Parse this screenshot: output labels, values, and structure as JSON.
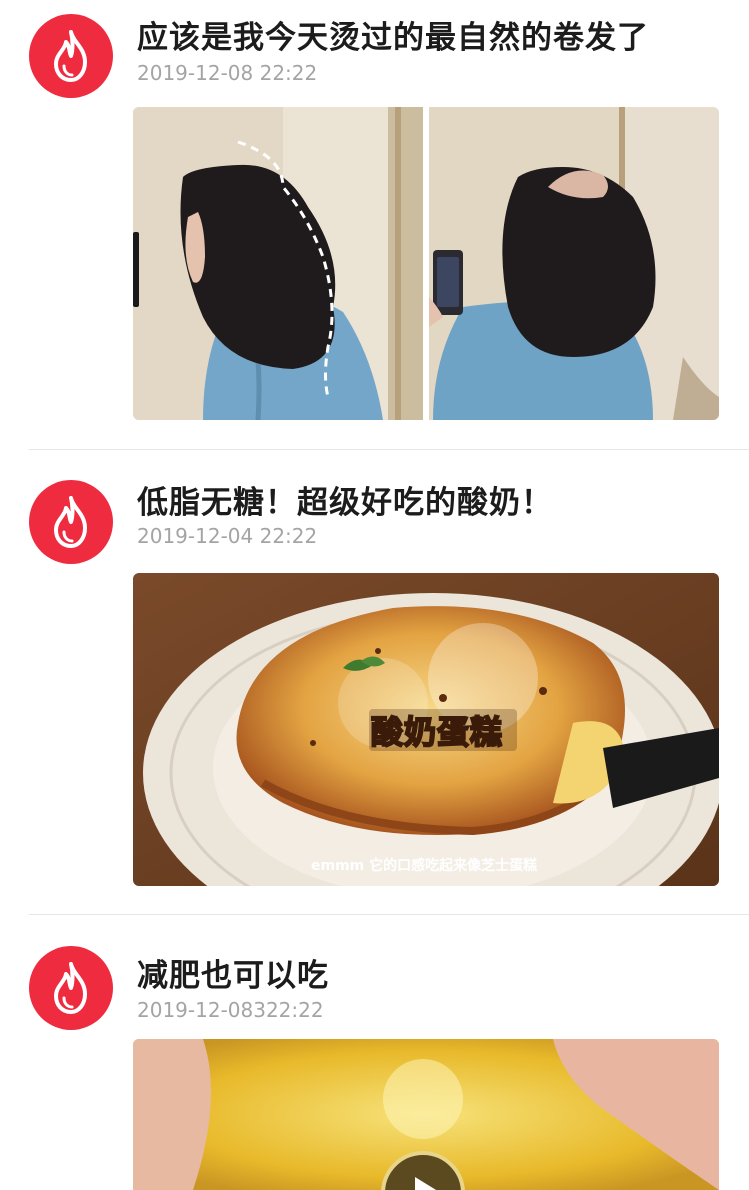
{
  "colors": {
    "brand": "#ef2b40",
    "title": "#1c1c1c",
    "date": "#a4a4a4"
  },
  "posts": [
    {
      "avatar_icon": "flame-icon",
      "title": "应该是我今天烫过的最自然的卷发了",
      "date": "2019-12-08 22:22",
      "media": "two photos of a girl with wavy dark hair in a blue hoodie"
    },
    {
      "avatar_icon": "flame-icon",
      "title": "低脂无糖！超级好吃的酸奶！",
      "date": "2019-12-04 22:22",
      "media": {
        "overlay_text": "酸奶蛋糕",
        "caption": "emmm 它的口感吃起来像芝士蛋糕"
      }
    },
    {
      "avatar_icon": "flame-icon",
      "title": "减肥也可以吃",
      "date": "2019-12-08322:22",
      "media": {
        "play_icon": "play-icon"
      }
    }
  ]
}
